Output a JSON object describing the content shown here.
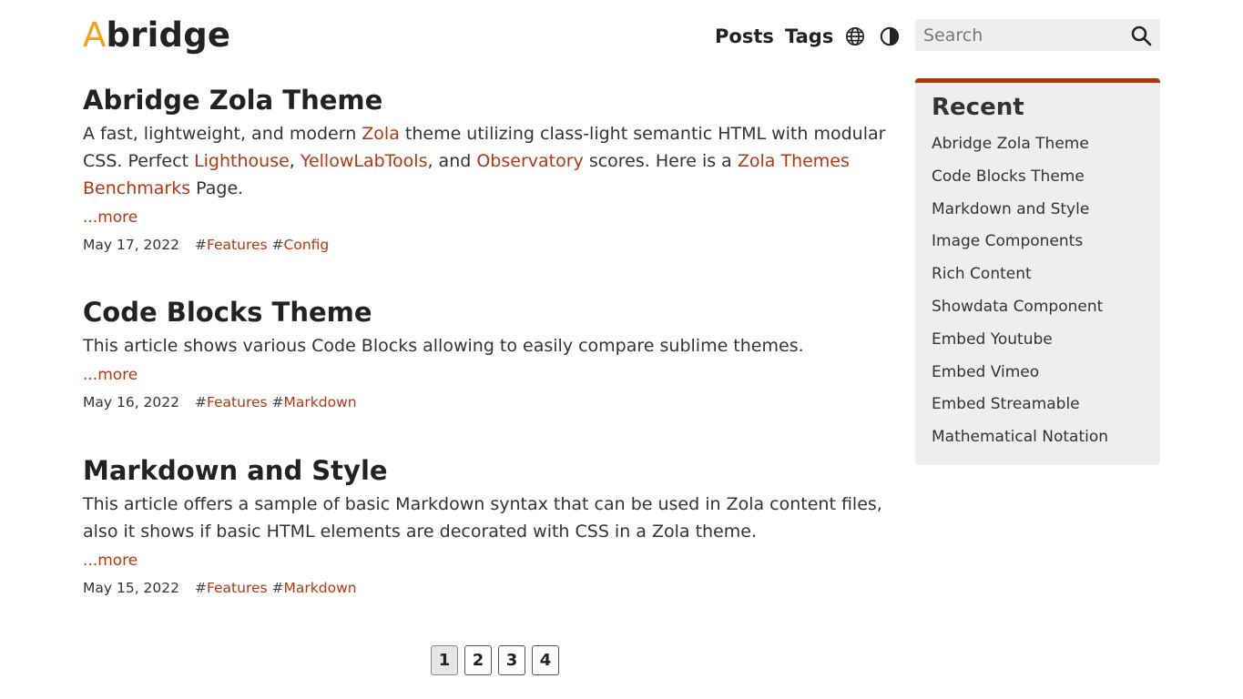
{
  "brand": {
    "first_letter": "A",
    "rest": "bridge",
    "colors": {
      "accent": "#b5370e",
      "logo_letter": "#f2a51b"
    }
  },
  "nav": {
    "posts": "Posts",
    "tags": "Tags",
    "language_icon": "globe-icon",
    "theme_icon": "contrast-icon"
  },
  "search": {
    "placeholder": "Search",
    "icon": "search-icon"
  },
  "posts": [
    {
      "title": "Abridge Zola Theme",
      "summary_parts": {
        "p1": "A fast, lightweight, and modern ",
        "l1": "Zola",
        "p2": " theme utilizing class-light semantic HTML with modular CSS. Perfect ",
        "l2": "Lighthouse",
        "p3": ", ",
        "l3": "YellowLabTools",
        "p4": ", and ",
        "l4": "Observatory",
        "p5": " scores. Here is a ",
        "l5": "Zola Themes Benchmarks",
        "p6": " Page."
      },
      "more": "...more",
      "date": "May 17, 2022",
      "tags": [
        "Features",
        "Config"
      ]
    },
    {
      "title": "Code Blocks Theme",
      "summary": "This article shows various Code Blocks allowing to easily compare sublime themes.",
      "more": "...more",
      "date": "May 16, 2022",
      "tags": [
        "Features",
        "Markdown"
      ]
    },
    {
      "title": "Markdown and Style",
      "summary": "This article offers a sample of basic Markdown syntax that can be used in Zola content files, also it shows if basic HTML elements are decorated with CSS in a Zola theme.",
      "more": "...more",
      "date": "May 15, 2022",
      "tags": [
        "Features",
        "Markdown"
      ]
    }
  ],
  "tag_prefix": "#",
  "pagination": {
    "pages": [
      "1",
      "2",
      "3",
      "4"
    ],
    "current": "1"
  },
  "sidebar": {
    "title": "Recent",
    "items": [
      "Abridge Zola Theme",
      "Code Blocks Theme",
      "Markdown and Style",
      "Image Components",
      "Rich Content",
      "Showdata Component",
      "Embed Youtube",
      "Embed Vimeo",
      "Embed Streamable",
      "Mathematical Notation"
    ]
  }
}
